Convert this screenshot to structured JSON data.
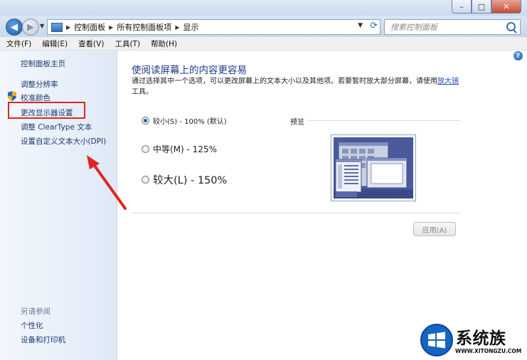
{
  "window": {
    "buttons": {
      "minimize": "–",
      "maximize": "□",
      "close": "✕"
    }
  },
  "nav": {
    "back_glyph": "◀",
    "forward_glyph": "▶",
    "breadcrumb": [
      "控制面板",
      "所有控制面板项",
      "显示"
    ],
    "search_placeholder": "搜索控制面板"
  },
  "menu": [
    "文件(F)",
    "编辑(E)",
    "查看(V)",
    "工具(T)",
    "帮助(H)"
  ],
  "sidebar": {
    "home": "控制面板主页",
    "links": [
      "调整分辨率",
      "校准颜色",
      "更改显示器设置",
      "调整 ClearType 文本",
      "设置自定义文本大小(DPI)"
    ],
    "see_also_heading": "另请参阅",
    "see_also": [
      "个性化",
      "设备和打印机"
    ]
  },
  "main": {
    "title": "使阅读屏幕上的内容更容易",
    "desc_part1": "通过选择其中一个选项，可以更改屏幕上的文本大小以及其他项。若要暂时放大部分屏幕，请使用",
    "desc_link": "放大镜",
    "desc_part2": "工具。",
    "options": [
      {
        "label": "较小(S) - 100% (默认)",
        "checked": true
      },
      {
        "label": "中等(M) - 125%",
        "checked": false
      },
      {
        "label": "较大(L) - 150%",
        "checked": false
      }
    ],
    "preview_label": "预览",
    "apply_button": "应用(A)",
    "help_glyph": "?"
  },
  "annotation": {
    "highlight_color": "#e0261f"
  },
  "watermark": {
    "name": "系统族",
    "url": "WWW.XITONGZU.COM"
  },
  "icons": [
    "back-icon",
    "forward-icon",
    "search-icon",
    "refresh-icon",
    "shield-icon",
    "help-icon",
    "windows-logo-icon"
  ]
}
